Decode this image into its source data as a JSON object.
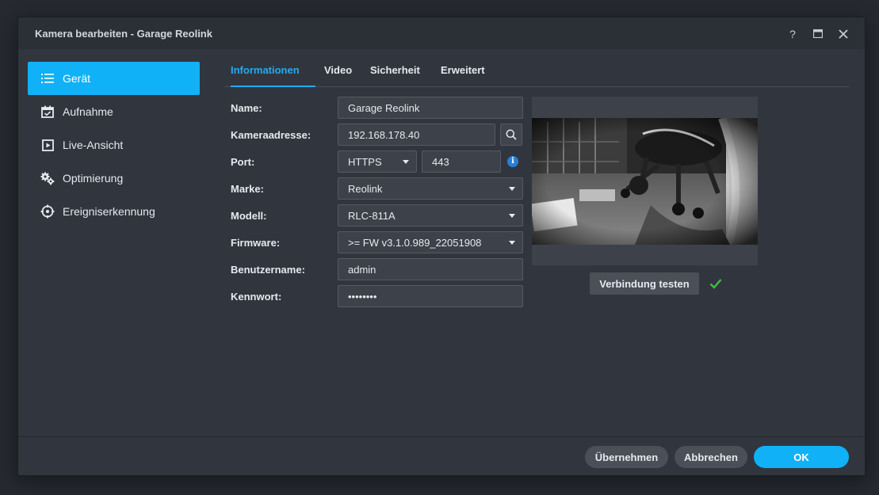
{
  "window": {
    "title": "Kamera bearbeiten - Garage Reolink",
    "help_glyph": "?"
  },
  "sidebar": {
    "items": [
      {
        "label": "Gerät",
        "icon": "list-icon",
        "active": true
      },
      {
        "label": "Aufnahme",
        "icon": "calendar-check-icon"
      },
      {
        "label": "Live-Ansicht",
        "icon": "play-box-icon"
      },
      {
        "label": "Optimierung",
        "icon": "gears-icon"
      },
      {
        "label": "Ereigniserkennung",
        "icon": "crosshair-icon"
      }
    ]
  },
  "tabs": [
    {
      "label": "Informationen",
      "active": true
    },
    {
      "label": "Video"
    },
    {
      "label": "Sicherheit"
    },
    {
      "label": "Erweitert"
    }
  ],
  "form": {
    "name_label": "Name:",
    "name_value": "Garage Reolink",
    "address_label": "Kameraadresse:",
    "address_value": "192.168.178.40",
    "port_label": "Port:",
    "port_protocol": "HTTPS",
    "port_value": "443",
    "brand_label": "Marke:",
    "brand_value": "Reolink",
    "model_label": "Modell:",
    "model_value": "RLC-811A",
    "firmware_label": "Firmware:",
    "firmware_value": ">= FW v3.1.0.989_22051908",
    "username_label": "Benutzername:",
    "username_value": "admin",
    "password_label": "Kennwort:",
    "password_value": "••••••••"
  },
  "preview": {
    "test_button": "Verbindung testen",
    "status": "success"
  },
  "footer": {
    "apply": "Übernehmen",
    "cancel": "Abbrechen",
    "ok": "OK"
  },
  "colors": {
    "accent": "#10b1f7",
    "success": "#3fbf3f",
    "info": "#2a7fd4"
  }
}
